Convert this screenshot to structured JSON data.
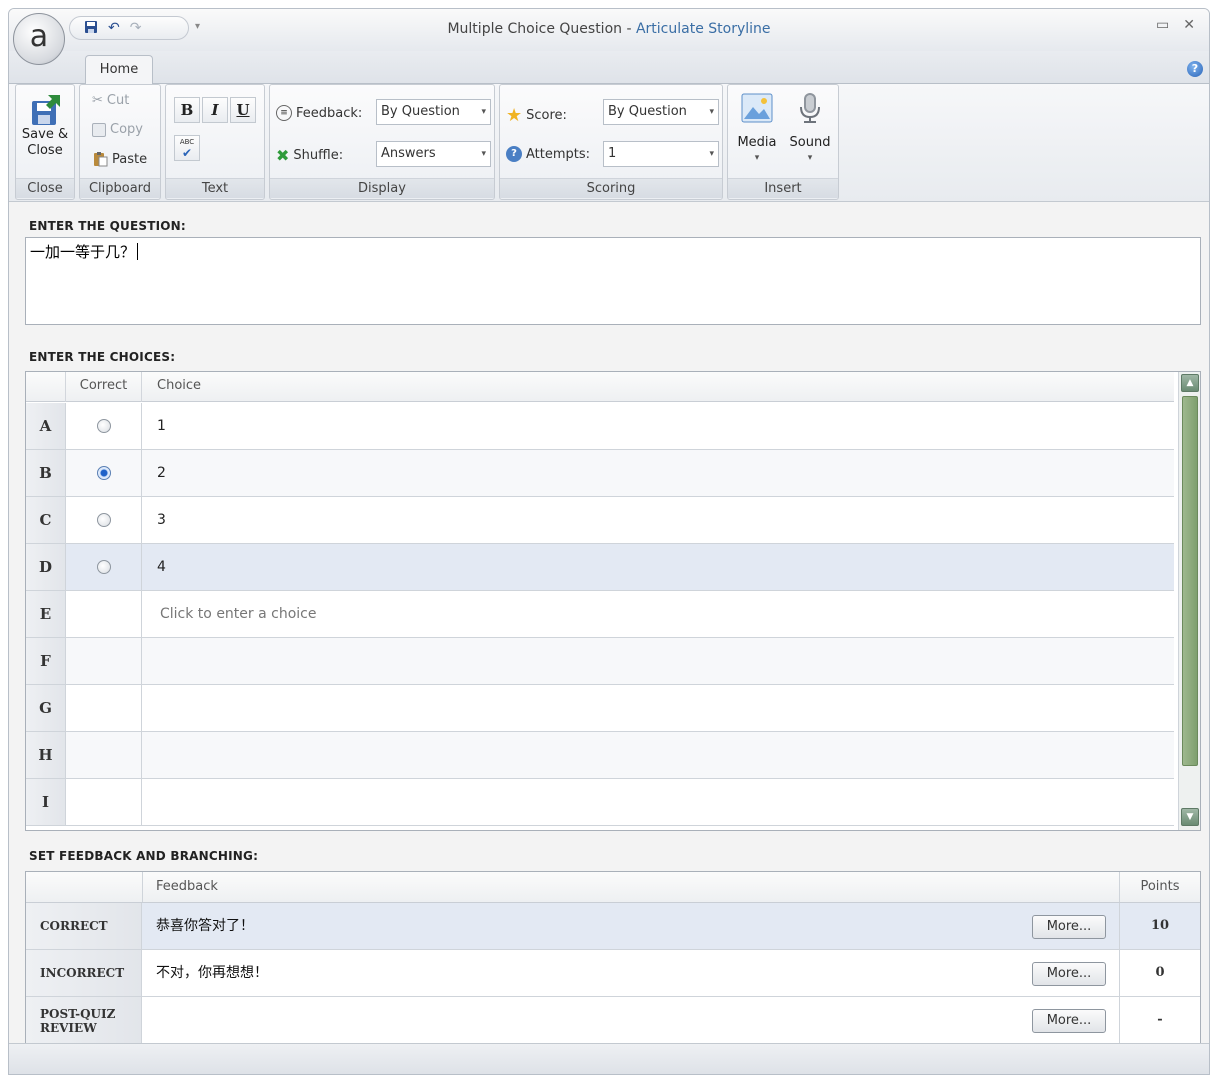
{
  "window": {
    "title_doc": "Multiple Choice Question",
    "title_sep": " - ",
    "title_app": "Articulate Storyline",
    "app_orb_letter": "a"
  },
  "tabs": [
    {
      "label": "Home",
      "active": true
    }
  ],
  "ribbon": {
    "close_group": {
      "label": "Close",
      "save_close_line1": "Save &",
      "save_close_line2": "Close"
    },
    "clipboard_group": {
      "label": "Clipboard",
      "cut": "Cut",
      "copy": "Copy",
      "paste": "Paste"
    },
    "text_group": {
      "label": "Text",
      "bold": "B",
      "italic": "I",
      "underline": "U",
      "spell": "ABC"
    },
    "display_group": {
      "label": "Display",
      "feedback_label": "Feedback:",
      "feedback_value": "By Question",
      "shuffle_label": "Shuffle:",
      "shuffle_value": "Answers"
    },
    "scoring_group": {
      "label": "Scoring",
      "score_label": "Score:",
      "score_value": "By Question",
      "attempts_label": "Attempts:",
      "attempts_value": "1"
    },
    "insert_group": {
      "label": "Insert",
      "media": "Media",
      "sound": "Sound"
    }
  },
  "question": {
    "section_label": "ENTER THE QUESTION:",
    "text": "一加一等于几？"
  },
  "choices": {
    "section_label": "ENTER THE CHOICES:",
    "col_correct": "Correct",
    "col_choice": "Choice",
    "rows": [
      {
        "letter": "A",
        "text": "1",
        "correct": false,
        "has_radio": true
      },
      {
        "letter": "B",
        "text": "2",
        "correct": true,
        "has_radio": true
      },
      {
        "letter": "C",
        "text": "3",
        "correct": false,
        "has_radio": true
      },
      {
        "letter": "D",
        "text": "4",
        "correct": false,
        "has_radio": true,
        "selected": true
      },
      {
        "letter": "E",
        "text": "",
        "placeholder": "Click to enter a choice",
        "has_radio": false
      },
      {
        "letter": "F",
        "text": "",
        "has_radio": false
      },
      {
        "letter": "G",
        "text": "",
        "has_radio": false
      },
      {
        "letter": "H",
        "text": "",
        "has_radio": false
      },
      {
        "letter": "I",
        "text": "",
        "has_radio": false
      }
    ]
  },
  "feedback": {
    "section_label": "SET FEEDBACK AND BRANCHING:",
    "col_feedback": "Feedback",
    "col_points": "Points",
    "more_label": "More...",
    "rows": [
      {
        "category": "CORRECT",
        "text": "恭喜你答对了！",
        "points": "10"
      },
      {
        "category": "INCORRECT",
        "text": "不对，你再想想！",
        "points": "0"
      },
      {
        "category": "POST-QUIZ REVIEW",
        "text": "",
        "points": "-"
      }
    ]
  },
  "colors": {
    "accent": "#3a6ea5",
    "scrollbar": "#7fa06f",
    "selected_row": "#e3e9f3"
  }
}
